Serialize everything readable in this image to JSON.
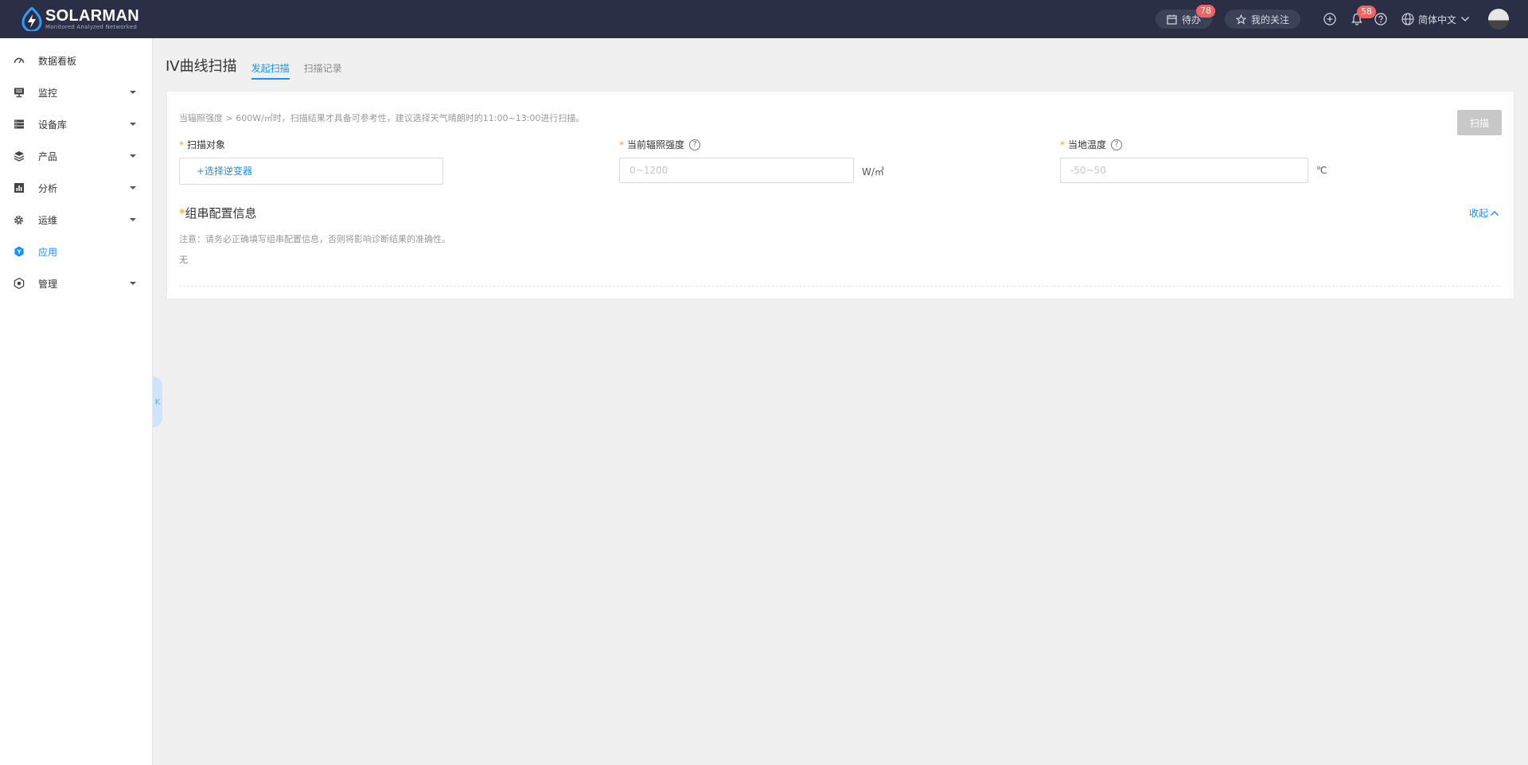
{
  "brand": {
    "name": "SOLARMAN",
    "tagline": "Monitored Analyzed Networked"
  },
  "topbar": {
    "todo_label": "待办",
    "todo_count": "78",
    "favorites_label": "我的关注",
    "notification_count": "58",
    "language": "简体中文"
  },
  "sidebar": {
    "items": [
      {
        "label": "数据看板",
        "icon": "dashboard-icon",
        "expandable": false
      },
      {
        "label": "监控",
        "icon": "monitor-icon",
        "expandable": true
      },
      {
        "label": "设备库",
        "icon": "device-library-icon",
        "expandable": true
      },
      {
        "label": "产品",
        "icon": "product-layers-icon",
        "expandable": true
      },
      {
        "label": "分析",
        "icon": "analysis-chart-icon",
        "expandable": true
      },
      {
        "label": "运维",
        "icon": "maintenance-gear-icon",
        "expandable": true
      },
      {
        "label": "应用",
        "icon": "application-icon",
        "expandable": false,
        "active": true
      },
      {
        "label": "管理",
        "icon": "management-icon",
        "expandable": true
      }
    ],
    "collapse_glyph": "K"
  },
  "page": {
    "title": "IV曲线扫描",
    "tabs": [
      {
        "label": "发起扫描",
        "active": true
      },
      {
        "label": "扫描记录",
        "active": false
      }
    ]
  },
  "form": {
    "tip": "当辐照强度 > 600W/㎡时，扫描结果才具备可参考性，建议选择天气晴朗时的11:00~13:00进行扫描。",
    "scan_button": "扫描",
    "target": {
      "label": "扫描对象",
      "select_text": "+选择逆变器"
    },
    "irradiance": {
      "label": "当前辐照强度",
      "placeholder": "0~1200",
      "unit": "W/㎡"
    },
    "temperature": {
      "label": "当地温度",
      "placeholder": "-50~50",
      "unit": "℃"
    },
    "help_glyph": "?",
    "required_mark": "*"
  },
  "string_config": {
    "title": "组串配置信息",
    "collapse_label": "收起",
    "note": "注意：请务必正确填写组串配置信息，否则将影响诊断结果的准确性。",
    "empty_text": "无"
  },
  "colors": {
    "topbar": "#2b2f45",
    "accent": "#1890ff",
    "required": "#f5a623",
    "badge": "#f26464"
  }
}
